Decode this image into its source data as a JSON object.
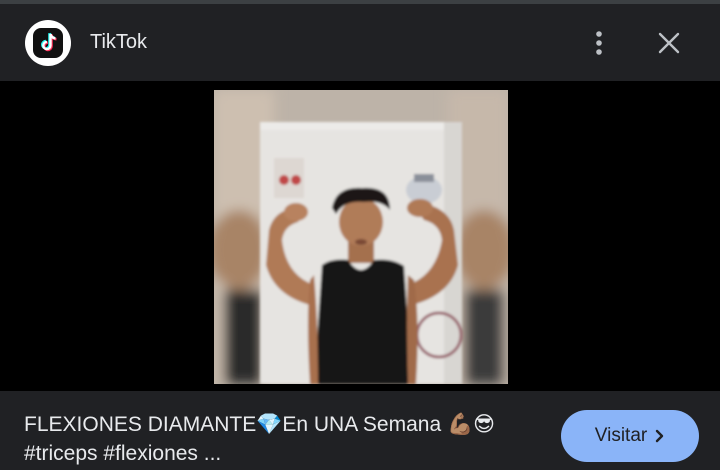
{
  "header": {
    "app_title": "TikTok",
    "logo_icon": "tiktok-logo-icon",
    "more_icon": "more-vert-icon",
    "close_icon": "close-icon"
  },
  "preview": {
    "image_alt": "Young man in black tank top flexing both arms"
  },
  "footer": {
    "caption_line1": "FLEXIONES DIAMANTE",
    "caption_emoji_gem": "💎",
    "caption_line1b": "En UNA Semana ",
    "caption_emoji_muscle": "💪🏽",
    "caption_emoji_cool": "😎",
    "caption_line2": "#triceps #flexiones ...",
    "visit_label": "Visitar",
    "visit_icon": "chevron-right-icon"
  },
  "colors": {
    "background": "#202124",
    "viewer": "#000000",
    "accent": "#8ab4f8",
    "text": "#e8eaed"
  }
}
